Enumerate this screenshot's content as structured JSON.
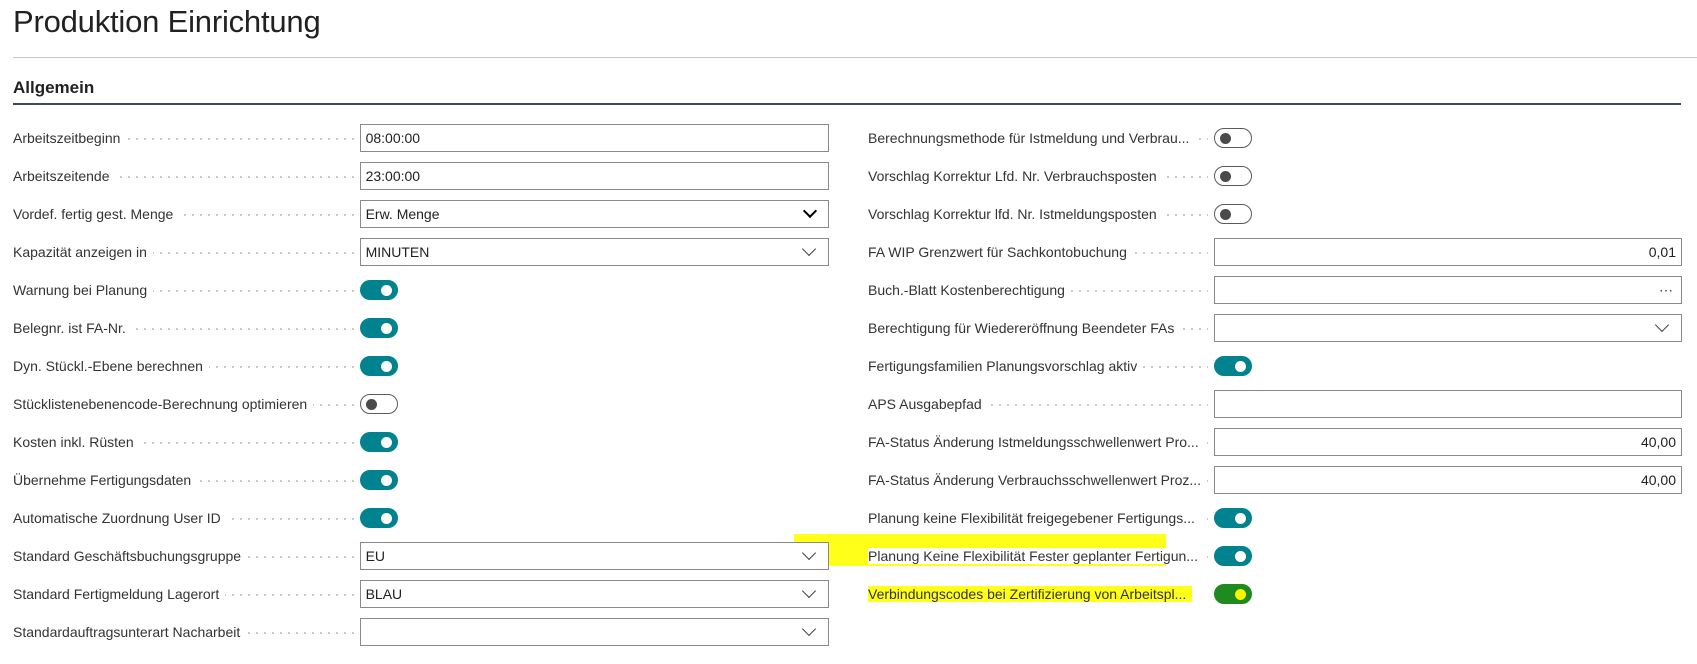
{
  "page": {
    "title": "Produktion Einrichtung"
  },
  "section": {
    "title": "Allgemein"
  },
  "left_fields": [
    {
      "label": "Arbeitszeitbeginn",
      "type": "text",
      "value": "08:00:00"
    },
    {
      "label": "Arbeitszeitende",
      "type": "text",
      "value": "23:00:00"
    },
    {
      "label": "Vordef. fertig gest. Menge",
      "type": "select",
      "value": "Erw. Menge"
    },
    {
      "label": "Kapazität anzeigen in",
      "type": "dropdown",
      "value": "MINUTEN"
    },
    {
      "label": "Warnung bei Planung",
      "type": "toggle",
      "on": true
    },
    {
      "label": "Belegnr. ist FA-Nr.",
      "type": "toggle",
      "on": true
    },
    {
      "label": "Dyn. Stückl.-Ebene berechnen",
      "type": "toggle",
      "on": true
    },
    {
      "label": "Stücklistenebenencode-Berechnung optimieren",
      "type": "toggle",
      "on": false
    },
    {
      "label": "Kosten inkl. Rüsten",
      "type": "toggle",
      "on": true
    },
    {
      "label": "Übernehme Fertigungsdaten",
      "type": "toggle",
      "on": true
    },
    {
      "label": "Automatische Zuordnung User ID",
      "type": "toggle",
      "on": true
    },
    {
      "label": "Standard Geschäftsbuchungsgruppe",
      "type": "dropdown",
      "value": "EU"
    },
    {
      "label": "Standard Fertigmeldung Lagerort",
      "type": "dropdown",
      "value": "BLAU"
    },
    {
      "label": "Standardauftragsunterart Nacharbeit",
      "type": "dropdown",
      "value": ""
    }
  ],
  "right_fields": [
    {
      "label": "Berechnungsmethode für Istmeldung und Verbrau...",
      "type": "toggle",
      "on": false
    },
    {
      "label": "Vorschlag Korrektur Lfd. Nr. Verbrauchsposten",
      "type": "toggle",
      "on": false
    },
    {
      "label": "Vorschlag Korrektur lfd. Nr. Istmeldungsposten",
      "type": "toggle",
      "on": false
    },
    {
      "label": "FA WIP Grenzwert für Sachkontobuchung",
      "type": "number",
      "value": "0,01"
    },
    {
      "label": "Buch.-Blatt Kostenberechtigung",
      "type": "lookup",
      "value": ""
    },
    {
      "label": "Berechtigung für Wiedereröffnung Beendeter FAs",
      "type": "dropdown",
      "value": ""
    },
    {
      "label": "Fertigungsfamilien Planungsvorschlag aktiv",
      "type": "toggle",
      "on": true
    },
    {
      "label": "APS Ausgabepfad",
      "type": "text",
      "value": ""
    },
    {
      "label": "FA-Status Änderung Istmeldungsschwellenwert Pro...",
      "type": "number",
      "value": "40,00"
    },
    {
      "label": "FA-Status Änderung Verbrauchsschwellenwert Proz...",
      "type": "number",
      "value": "40,00"
    },
    {
      "label": "Planung keine Flexibilität freigegebener Fertigungs...",
      "type": "toggle",
      "on": true
    },
    {
      "label": "Planung Keine Flexibilität Fester geplanter Fertigun...",
      "type": "toggle",
      "on": true
    },
    {
      "label": "Verbindungscodes bei Zertifizierung von Arbeitspl...",
      "type": "toggle",
      "on": true,
      "highlighted": true
    }
  ],
  "colors": {
    "accent": "#00838f",
    "highlight": "#ffff1a",
    "highlight_toggle": "#1f8a1f",
    "section_rule": "#3a4a5c"
  }
}
